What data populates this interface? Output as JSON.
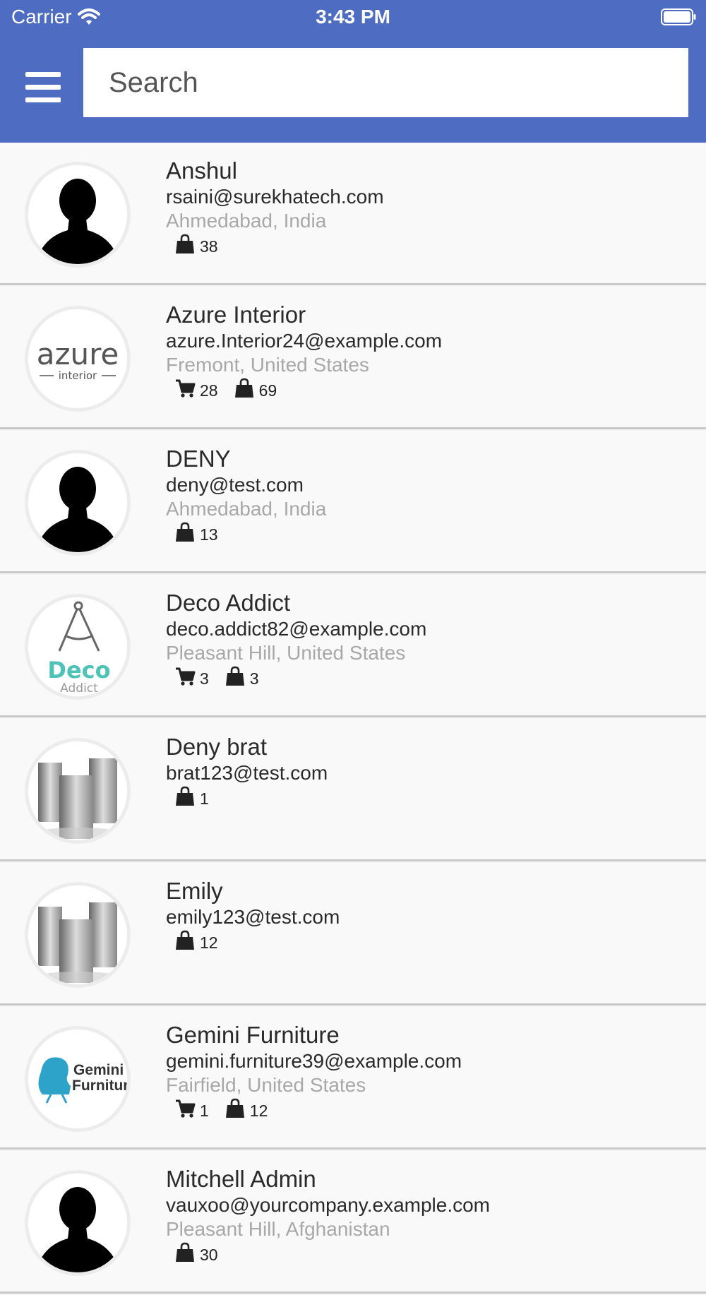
{
  "status_bar": {
    "carrier": "Carrier",
    "time": "3:43 PM"
  },
  "search": {
    "placeholder": "Search"
  },
  "icons": {
    "menu": "hamburger-icon",
    "cart": "cart-icon",
    "bag": "shopping-bag-icon"
  },
  "customers": [
    {
      "name": "Anshul",
      "email": "rsaini@surekhatech.com",
      "location": "Ahmedabad, India",
      "cart_count": "",
      "order_count": "38",
      "avatar": "person-silhouette"
    },
    {
      "name": "Azure Interior",
      "email": "azure.Interior24@example.com",
      "location": "Fremont, United States",
      "cart_count": "28",
      "order_count": "69",
      "avatar": "azure-interior-logo"
    },
    {
      "name": "DENY",
      "email": "deny@test.com",
      "location": "Ahmedabad, India",
      "cart_count": "",
      "order_count": "13",
      "avatar": "person-silhouette"
    },
    {
      "name": "Deco Addict",
      "email": "deco.addict82@example.com",
      "location": "Pleasant Hill, United States",
      "cart_count": "3",
      "order_count": "3",
      "avatar": "deco-addict-logo"
    },
    {
      "name": "Deny brat",
      "email": "brat123@test.com",
      "location": "",
      "cart_count": "",
      "order_count": "1",
      "avatar": "company-buildings"
    },
    {
      "name": "Emily",
      "email": "emily123@test.com",
      "location": "",
      "cart_count": "",
      "order_count": "12",
      "avatar": "company-buildings"
    },
    {
      "name": "Gemini Furniture",
      "email": "gemini.furniture39@example.com",
      "location": "Fairfield, United States",
      "cart_count": "1",
      "order_count": "12",
      "avatar": "gemini-furniture-logo"
    },
    {
      "name": "Mitchell Admin",
      "email": "vauxoo@yourcompany.example.com",
      "location": "Pleasant Hill, Afghanistan",
      "cart_count": "",
      "order_count": "30",
      "avatar": "person-silhouette"
    }
  ],
  "logos": {
    "azure": {
      "title": "azure",
      "subtitle": "interior"
    },
    "deco": {
      "title": "Deco",
      "subtitle": "Addict"
    },
    "gemini": {
      "line1": "Gemini",
      "line2": "Furniture"
    }
  },
  "colors": {
    "header": "#4e6cc1",
    "deco_accent": "#4fc3b8",
    "gemini_accent": "#2ea3c9"
  }
}
